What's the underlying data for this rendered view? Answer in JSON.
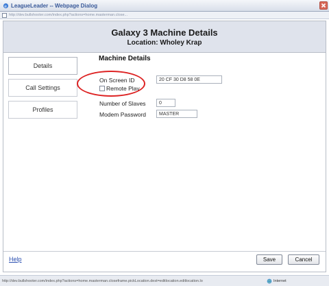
{
  "window": {
    "title": "LeagueLeader -- Webpage Dialog",
    "address": "http://dev.bullshooter.com/index.php?actions=home.masterman.close..."
  },
  "header": {
    "title": "Galaxy 3 Machine Details",
    "location": "Location: Wholey Krap"
  },
  "tabs": [
    {
      "label": "Details"
    },
    {
      "label": "Call Settings"
    },
    {
      "label": "Profiles"
    }
  ],
  "section": {
    "title": "Machine Details"
  },
  "form": {
    "on_screen_id_label": "On Screen ID",
    "on_screen_id_value": "20 CF 30 D8 58 0E",
    "remote_play_label": "Remote Play",
    "num_slaves_label": "Number of Slaves",
    "num_slaves_value": "0",
    "modem_password_label": "Modem Password",
    "modem_password_value": "MASTER"
  },
  "footer": {
    "help_label": "Help",
    "save_label": "Save",
    "cancel_label": "Cancel"
  },
  "status": {
    "url": "http://dev.bullshooter.com/index.php?actions=home.masterman.closeframe.pickLocation.dest=editlocation.editlocation.lo",
    "zone": "Internet"
  },
  "colors": {
    "annotation_circle": "#dd2222",
    "header_bg": "#dfe3ec",
    "link": "#2a4fb0"
  }
}
